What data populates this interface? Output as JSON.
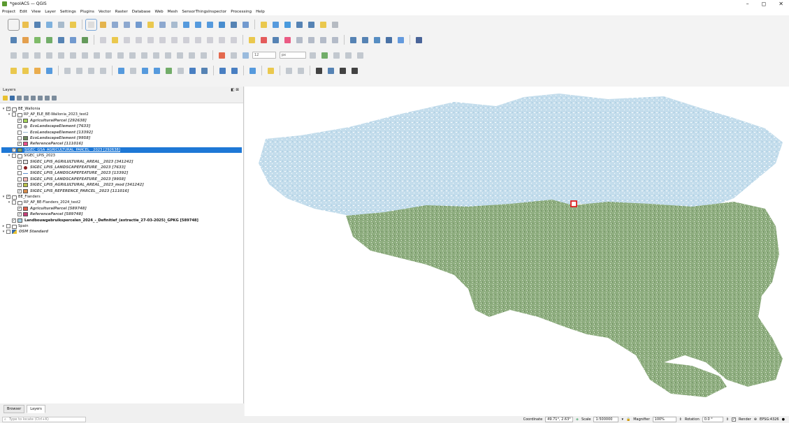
{
  "window": {
    "title": "*geoIACS — QGIS",
    "controls": [
      "–",
      "◻",
      "✕"
    ]
  },
  "menu": [
    "Project",
    "Edit",
    "View",
    "Layer",
    "Settings",
    "Plugins",
    "Vector",
    "Raster",
    "Database",
    "Web",
    "Mesh",
    "SensorThingsInspector",
    "Processing",
    "Help"
  ],
  "toolbar": {
    "font_size_value": "12",
    "unit_value": "px"
  },
  "layers_panel": {
    "title": "Layers",
    "controls": "◧ ⊠"
  },
  "tree": [
    {
      "level": 0,
      "expand": "▾",
      "checked": "✓",
      "type": "group",
      "label": "BE_Wallonia",
      "style": ""
    },
    {
      "level": 1,
      "expand": "▾",
      "checked": "",
      "type": "group",
      "label": "RP_AP_ELE_BE-Wallonia_2023_test2",
      "style": ""
    },
    {
      "level": 2,
      "expand": "",
      "checked": "✓",
      "type": "layer",
      "sym": "fill",
      "color": "#a6d45a",
      "label": "AgriculturalParcel [292638]",
      "style": "it"
    },
    {
      "level": 2,
      "expand": "",
      "checked": "",
      "type": "layer",
      "sym": "dot",
      "color": "#9a9a9a",
      "label": "EcoLandscapeElement [7633]",
      "style": "it"
    },
    {
      "level": 2,
      "expand": "",
      "checked": "",
      "type": "layer",
      "sym": "line",
      "color": "#9ab6d0",
      "label": "EcoLandscapeElement [13392]",
      "style": "it"
    },
    {
      "level": 2,
      "expand": "",
      "checked": "",
      "type": "layer",
      "sym": "fill",
      "color": "#6e8a5e",
      "label": "EcoLandscapeElement [9958]",
      "style": "it"
    },
    {
      "level": 2,
      "expand": "",
      "checked": "✓",
      "type": "layer",
      "sym": "fill",
      "color": "#e94f8c",
      "label": "ReferenceParcel [111016]",
      "style": "it"
    },
    {
      "level": 1,
      "expand": "",
      "checked": "✓",
      "type": "layer",
      "sym": "fill",
      "color": "#7ea66a",
      "label": "SIGEC_GSA_AGRICULTURAL_PARCEL__2023 [292638]",
      "style": "ul",
      "selected": true
    },
    {
      "level": 1,
      "expand": "▾",
      "checked": "",
      "type": "group",
      "label": "SIGEC_LPIS_2023",
      "style": ""
    },
    {
      "level": 2,
      "expand": "",
      "checked": "✓",
      "type": "layer",
      "sym": "fill",
      "color": "#e8e8e8",
      "label": "SIGEC_LPIS_AGRILULTURAL_AREAL__2023 [341242]",
      "style": "it"
    },
    {
      "level": 2,
      "expand": "",
      "checked": "",
      "type": "layer",
      "sym": "dot",
      "color": "#8b1e1e",
      "label": "SIGEC_LPIS_LANDSCAPEFEATURE__2023 [7633]",
      "style": "it"
    },
    {
      "level": 2,
      "expand": "",
      "checked": "",
      "type": "layer",
      "sym": "line",
      "color": "#5b8fd0",
      "label": "SIGEC_LPIS_LANDSCAPEFEATURE__2023 [13392]",
      "style": "it"
    },
    {
      "level": 2,
      "expand": "",
      "checked": "",
      "type": "layer",
      "sym": "fill",
      "color": "#f2b8b8",
      "label": "SIGEC_LPIS_LANDSCAPEFEATURE__2023 [9958]",
      "style": "it"
    },
    {
      "level": 2,
      "expand": "",
      "checked": "✓",
      "type": "layer",
      "sym": "fill",
      "color": "#b9c24a",
      "label": "SIGEC_LPIS_AGRILULTURAL_AREAL__2023_mod [341242]",
      "style": "it"
    },
    {
      "level": 2,
      "expand": "",
      "checked": "✓",
      "type": "layer",
      "sym": "fill",
      "color": "#d98c4a",
      "label": "SIGEC_LPIS_REFERENCE_PARCEL__2023 [111016]",
      "style": "it"
    },
    {
      "level": 0,
      "expand": "▾",
      "checked": "✓",
      "type": "group",
      "label": "BE_Flanders",
      "style": ""
    },
    {
      "level": 1,
      "expand": "▾",
      "checked": "",
      "type": "group",
      "label": "RP_AP_BE-Flanders_2024_test2",
      "style": ""
    },
    {
      "level": 2,
      "expand": "",
      "checked": "✓",
      "type": "layer",
      "sym": "fill",
      "color": "#e0604a",
      "label": "AgriculturalParcel [589748]",
      "style": "it"
    },
    {
      "level": 2,
      "expand": "",
      "checked": "✓",
      "type": "layer",
      "sym": "fill",
      "color": "#c8407a",
      "label": "ReferenceParcel [589748]",
      "style": "it"
    },
    {
      "level": 1,
      "expand": "",
      "checked": "✓",
      "type": "layer",
      "sym": "fill",
      "color": "#a9d4e6",
      "label": "Landbouwgebruikspercelen_2024_-_Definitief_(extractie_27-03-2025)_GPKG [589748]",
      "style": "b"
    },
    {
      "level": 0,
      "expand": "▸",
      "checked": "",
      "type": "group",
      "label": "Spain",
      "style": ""
    },
    {
      "level": 0,
      "expand": "▾",
      "checked": "",
      "type": "osm",
      "label": "OSM Standard",
      "style": "it"
    }
  ],
  "panel_tabs": [
    "Browser",
    "Layers"
  ],
  "statusbar": {
    "locator_placeholder": "Type to locate (Ctrl+K)",
    "coordinate_label": "Coordinate",
    "coordinate_value": "49.71°, 2.63°",
    "scale_label": "Scale",
    "scale_value": "1:500000",
    "magnifier_label": "Magnifier",
    "magnifier_value": "100%",
    "rotation_label": "Rotation",
    "rotation_value": "0.0 °",
    "render_label": "Render",
    "crs_label": "EPSG:4326"
  },
  "map": {
    "wallonia_color": "#bcd8ea",
    "flanders_color": "#8aa97a",
    "marker_color": "#e02020"
  }
}
